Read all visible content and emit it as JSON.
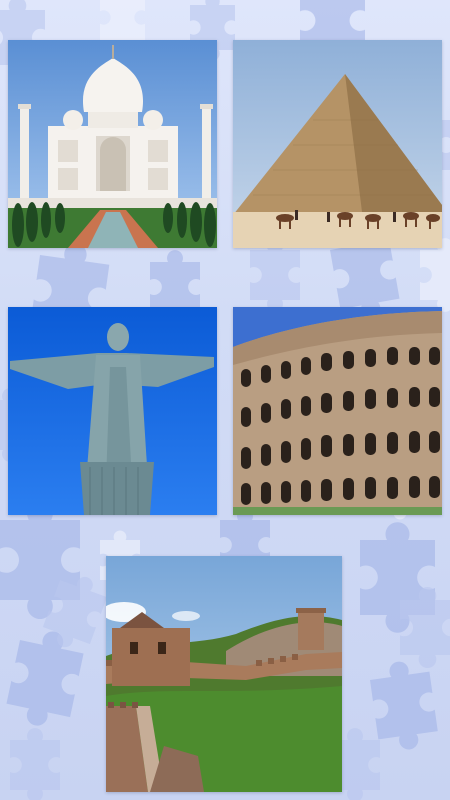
{
  "screen": {
    "background_color": "#d6dff6"
  },
  "gallery": {
    "tiles": [
      {
        "icon": "taj-mahal-image"
      },
      {
        "icon": "great-pyramid-image"
      },
      {
        "icon": "christ-the-redeemer-image"
      },
      {
        "icon": "colosseum-image"
      },
      {
        "icon": "great-wall-image"
      }
    ]
  }
}
